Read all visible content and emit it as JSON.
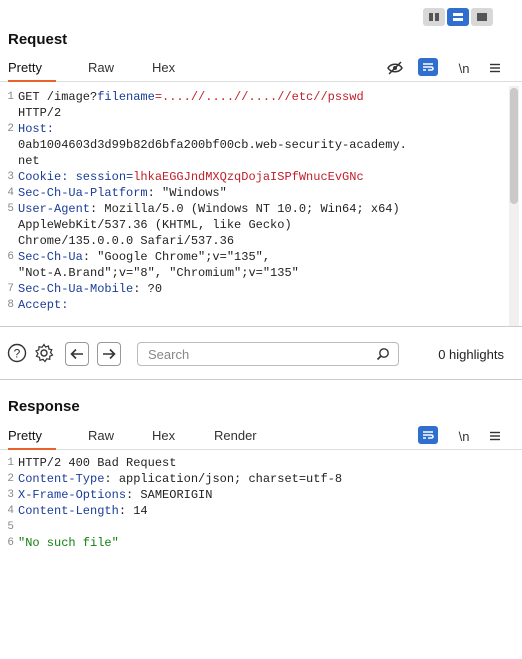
{
  "layout_toggle": {
    "icons": [
      "columns-layout-icon",
      "rows-layout-icon",
      "single-panel-icon"
    ]
  },
  "request": {
    "title": "Request",
    "tabs": [
      "Pretty",
      "Raw",
      "Hex"
    ],
    "active_tab": "Pretty",
    "toolbar": {
      "newline_label": "\\n"
    },
    "lines": [
      {
        "num": "1",
        "parts": [
          [
            "GET /image?",
            "plain"
          ],
          [
            "filename",
            "kw"
          ],
          [
            "=....//....//....//etc//psswd",
            "red"
          ]
        ]
      },
      {
        "num": "",
        "parts": [
          [
            "HTTP/2",
            "plain"
          ]
        ]
      },
      {
        "num": "2",
        "parts": [
          [
            "Host:",
            "kw"
          ]
        ]
      },
      {
        "num": "",
        "parts": [
          [
            "0ab1004603d3d99b82d6bfa200bf00cb.web-security-academy.",
            "plain"
          ]
        ]
      },
      {
        "num": "",
        "parts": [
          [
            "net",
            "plain"
          ]
        ]
      },
      {
        "num": "3",
        "parts": [
          [
            "Cookie: session=",
            "kw"
          ],
          [
            "lhkaEGGJndMXQzqDojaISPfWnucEvGNc",
            "red"
          ]
        ]
      },
      {
        "num": "4",
        "parts": [
          [
            "Sec-Ch-Ua-Platform",
            "kw"
          ],
          [
            ": \"Windows\"",
            "plain"
          ]
        ]
      },
      {
        "num": "5",
        "parts": [
          [
            "User-Agent",
            "kw"
          ],
          [
            ": Mozilla/5.0 (Windows NT 10.0; Win64; x64)",
            "plain"
          ]
        ]
      },
      {
        "num": "",
        "parts": [
          [
            "AppleWebKit/537.36 (KHTML, like Gecko)",
            "plain"
          ]
        ]
      },
      {
        "num": "",
        "parts": [
          [
            "Chrome/135.0.0.0 Safari/537.36",
            "plain"
          ]
        ]
      },
      {
        "num": "6",
        "parts": [
          [
            "Sec-Ch-Ua",
            "kw"
          ],
          [
            ": \"Google Chrome\";v=\"135\",",
            "plain"
          ]
        ]
      },
      {
        "num": "",
        "parts": [
          [
            "\"Not-A.Brand\";v=\"8\", \"Chromium\";v=\"135\"",
            "plain"
          ]
        ]
      },
      {
        "num": "7",
        "parts": [
          [
            "Sec-Ch-Ua-Mobile",
            "kw"
          ],
          [
            ": ?0",
            "plain"
          ]
        ]
      },
      {
        "num": "8",
        "parts": [
          [
            "Accept:",
            "kw"
          ]
        ]
      }
    ]
  },
  "search": {
    "placeholder": "Search",
    "value": "",
    "highlights_text": "0 highlights"
  },
  "response": {
    "title": "Response",
    "tabs": [
      "Pretty",
      "Raw",
      "Hex",
      "Render"
    ],
    "active_tab": "Pretty",
    "toolbar": {
      "newline_label": "\\n"
    },
    "lines": [
      {
        "num": "1",
        "parts": [
          [
            "HTTP/2 400 Bad Request",
            "plain"
          ]
        ]
      },
      {
        "num": "2",
        "parts": [
          [
            "Content-Type",
            "kw"
          ],
          [
            ": application/json; charset=utf-8",
            "plain"
          ]
        ]
      },
      {
        "num": "3",
        "parts": [
          [
            "X-Frame-Options",
            "kw"
          ],
          [
            ": SAMEORIGIN",
            "plain"
          ]
        ]
      },
      {
        "num": "4",
        "parts": [
          [
            "Content-Length",
            "kw"
          ],
          [
            ": 14",
            "plain"
          ]
        ]
      },
      {
        "num": "5",
        "parts": []
      },
      {
        "num": "6",
        "parts": [
          [
            "\"No such file\"",
            "green"
          ]
        ]
      }
    ]
  },
  "colors": {
    "accent_blue": "#2f6fd0",
    "tab_underline": "#e8622b",
    "header_blue": "#1a3d97",
    "value_red": "#c1202a",
    "string_green": "#108010"
  }
}
